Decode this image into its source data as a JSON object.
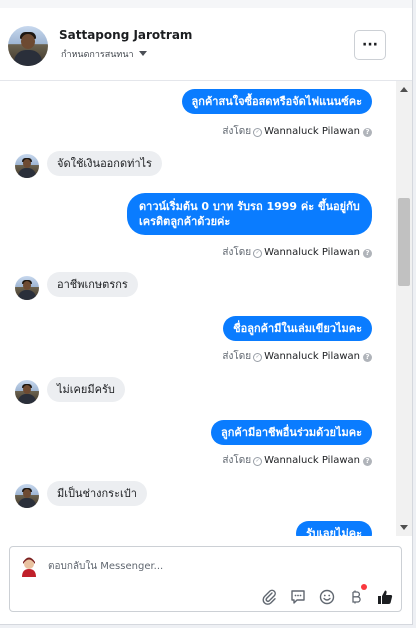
{
  "header": {
    "name": "Sattapong Jarotram",
    "subtitle": "กำหนดการสนทนา",
    "more_label": "···"
  },
  "messages": [
    {
      "dir": "out",
      "text": "ลูกค้าสนใจซื้อสดหรือจัดไฟแนนซ์คะ",
      "sent_by": "ส่งโดย",
      "agent": "Wannaluck Pilawan"
    },
    {
      "dir": "in",
      "text": "จัดใช้เงินออกดท่าไร"
    },
    {
      "dir": "out",
      "text": "ดาวน์เริ่มต้น 0 บาท รับรถ 1999 ค่ะ   ขึ้นอยู่กับเครดิตลูกค้าด้วยค่ะ",
      "sent_by": "ส่งโดย",
      "agent": "Wannaluck Pilawan"
    },
    {
      "dir": "in",
      "text": "อาชีพเกษตรกร"
    },
    {
      "dir": "out",
      "text": "ชื่อลูกค้ามีในเล่มเขียวไมคะ",
      "sent_by": "ส่งโดย",
      "agent": "Wannaluck Pilawan"
    },
    {
      "dir": "in",
      "text": "ไม่เคยมีครับ"
    },
    {
      "dir": "out",
      "text": "ลูกค้ามีอาชีพอื่นร่วมด้วยไมคะ",
      "sent_by": "ส่งโดย",
      "agent": "Wannaluck Pilawan"
    },
    {
      "dir": "in",
      "text": "มีเป็นช่างกระเป๋า"
    },
    {
      "dir": "out",
      "text": "รับเลยไม่คะ"
    }
  ],
  "composer": {
    "placeholder": "ตอบกลับใน Messenger..."
  },
  "colors": {
    "outgoing": "#0a7cff",
    "incoming": "#eceef1",
    "notification": "#fa383e"
  }
}
